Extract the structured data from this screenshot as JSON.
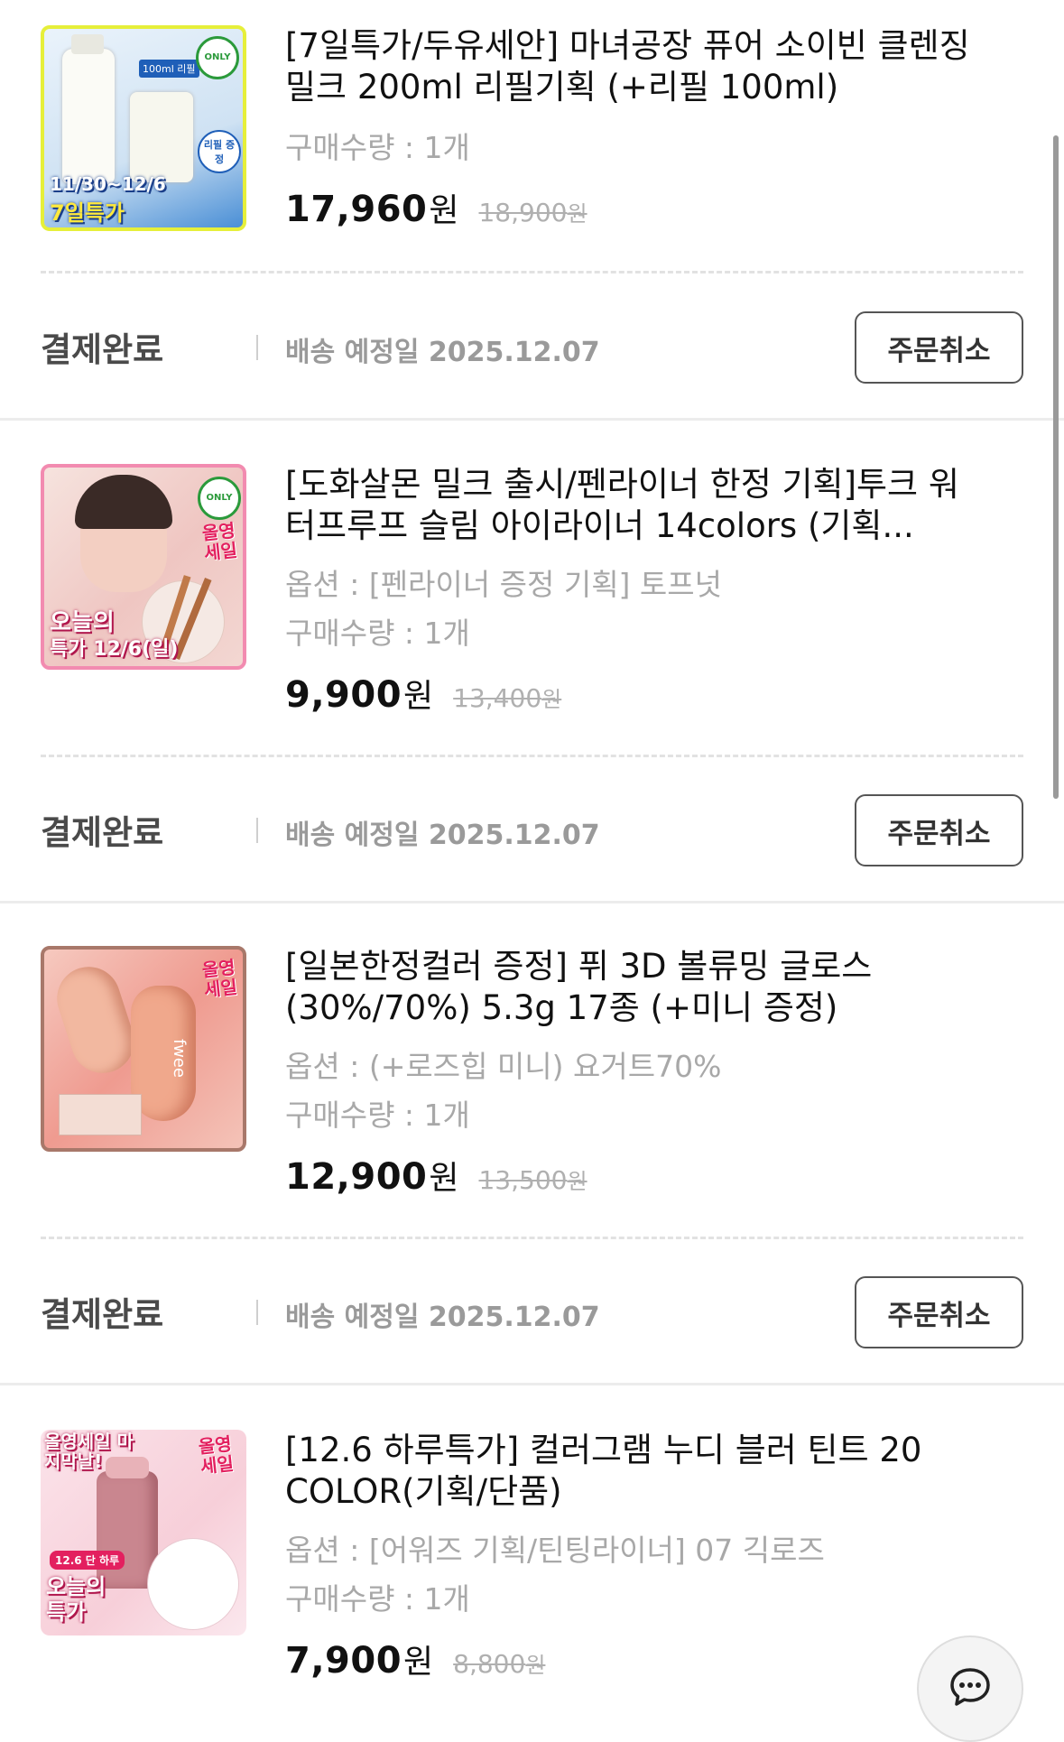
{
  "orders": [
    {
      "title": "[7일특가/두유세안] 마녀공장 퓨어 소이빈 클렌징 밀크 200ml 리필기획 (+리필 100ml)",
      "option": "",
      "quantity": "구매수량 : 1개",
      "price": "17,960",
      "currency": "원",
      "original_price": "18,900",
      "original_currency": "원",
      "thumb": {
        "line1": "11/30~12/6",
        "line2": "7일특가",
        "badge": "ONLY",
        "tag": "리필 증정",
        "pack": "100ml 리필"
      },
      "status": "결제완료",
      "shipping": "배송 예정일 2025.12.07",
      "cancel_label": "주문취소"
    },
    {
      "title": "[도화살몬 밀크 출시/펜라이너 한정 기획]투크 워터프루프 슬림 아이라이너 14colors (기획...",
      "option": "옵션 : [펜라이너 증정 기획] 토프넛",
      "quantity": "구매수량 : 1개",
      "price": "9,900",
      "currency": "원",
      "original_price": "13,400",
      "original_currency": "원",
      "thumb": {
        "line1": "오늘의",
        "line2": "특가 12/6(일)",
        "badge": "ONLY",
        "tag": "올영 세일"
      },
      "status": "결제완료",
      "shipping": "배송 예정일 2025.12.07",
      "cancel_label": "주문취소"
    },
    {
      "title": "[일본한정컬러 증정] 퓌 3D 볼류밍 글로스 (30%/70%) 5.3g 17종 (+미니 증정)",
      "option": "옵션 : (+로즈힙 미니) 요거트70%",
      "quantity": "구매수량 : 1개",
      "price": "12,900",
      "currency": "원",
      "original_price": "13,500",
      "original_currency": "원",
      "thumb": {
        "tag": "올영 세일",
        "brand": "fwee"
      },
      "status": "결제완료",
      "shipping": "배송 예정일 2025.12.07",
      "cancel_label": "주문취소"
    },
    {
      "title": "[12.6 하루특가] 컬러그램 누디 블러 틴트 20 COLOR(기획/단품)",
      "option": "옵션 : [어워즈 기획/틴팅라이너] 07 긱로즈",
      "quantity": "구매수량 : 1개",
      "price": "7,900",
      "currency": "원",
      "original_price": "8,800",
      "original_currency": "원",
      "thumb": {
        "line0": "올영세일 마지막날!",
        "line1": "12.6 단 하루",
        "line2": "오늘의 특가",
        "tag": "올영 세일"
      }
    }
  ],
  "colors": {
    "status_text": "#4a4a4a",
    "muted": "#a8a8a8",
    "button_border": "#555555",
    "divider": "#ececec"
  },
  "icons": {
    "chat": "chat-bubble-icon"
  }
}
